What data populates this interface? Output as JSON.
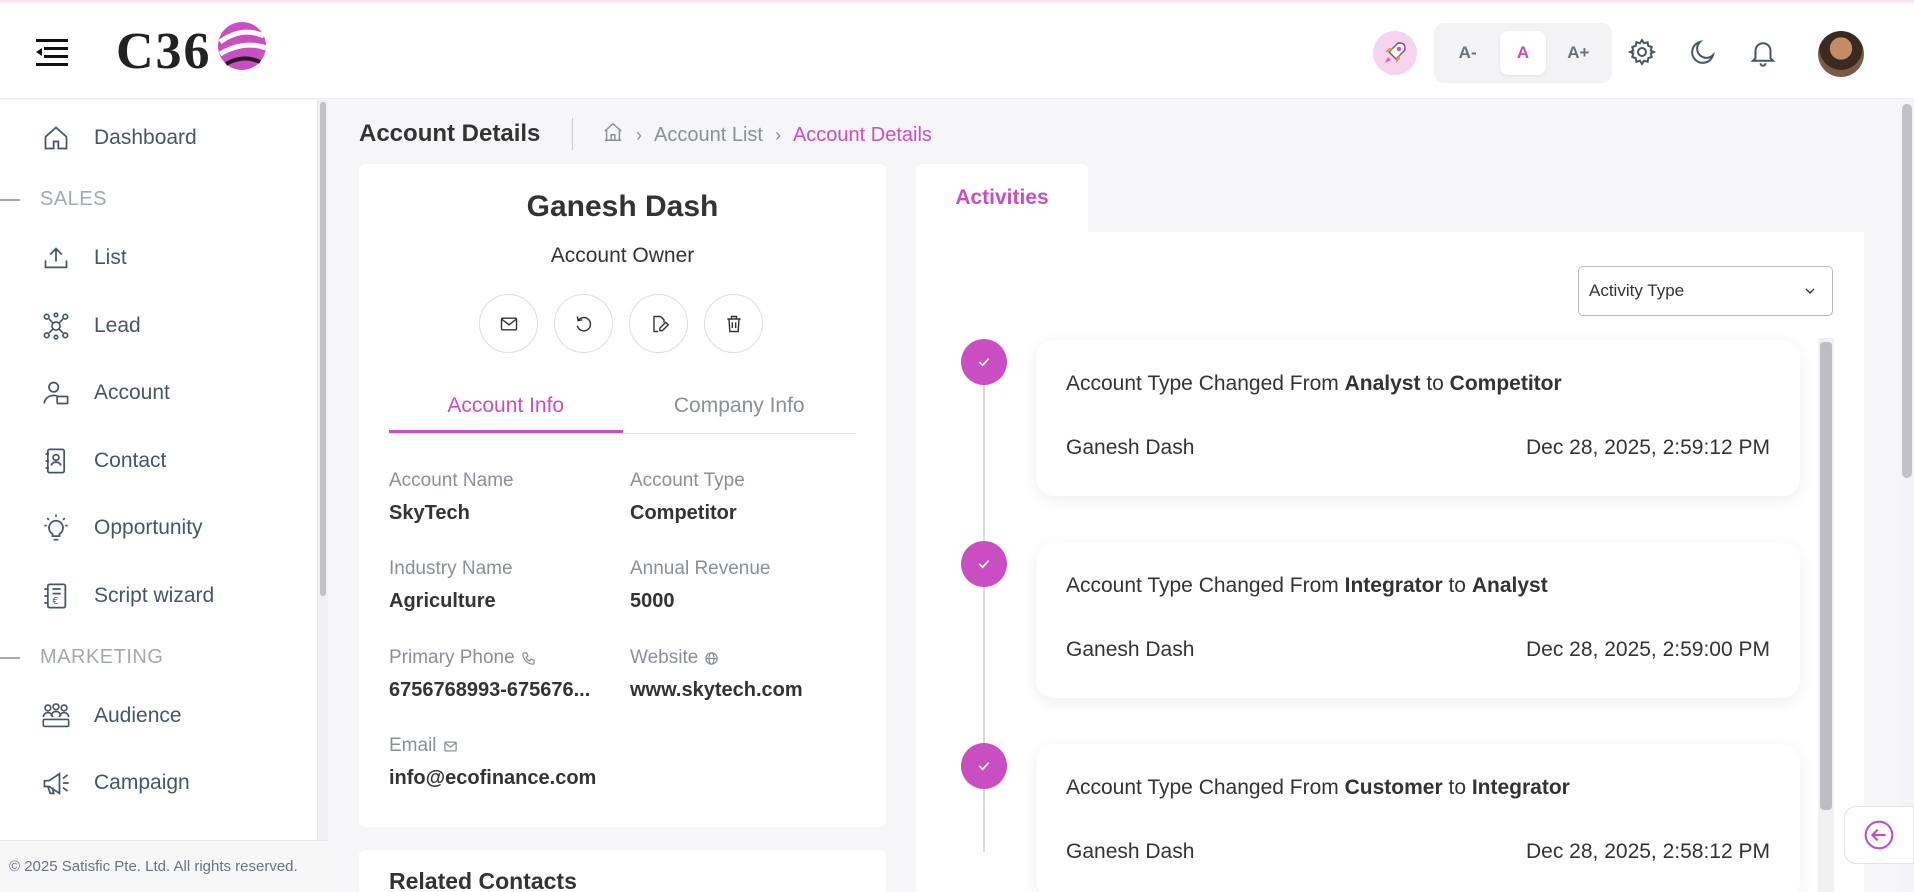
{
  "header": {
    "logo_text": "C36",
    "font_controls": [
      "A-",
      "A",
      "A+"
    ],
    "active_font_control": "A"
  },
  "sidebar": {
    "items": [
      {
        "label": "Dashboard",
        "icon": "home-icon"
      },
      {
        "section": "SALES"
      },
      {
        "label": "List",
        "icon": "upload-icon"
      },
      {
        "label": "Lead",
        "icon": "network-icon"
      },
      {
        "label": "Account",
        "icon": "user-card-icon"
      },
      {
        "label": "Contact",
        "icon": "contact-book-icon"
      },
      {
        "label": "Opportunity",
        "icon": "lightbulb-icon"
      },
      {
        "label": "Script wizard",
        "icon": "script-icon"
      },
      {
        "section": "MARKETING"
      },
      {
        "label": "Audience",
        "icon": "audience-icon"
      },
      {
        "label": "Campaign",
        "icon": "megaphone-icon"
      }
    ],
    "footer": "© 2025 Satisfic Pte. Ltd. All rights reserved."
  },
  "page": {
    "title": "Account Details",
    "breadcrumb": [
      "Account List",
      "Account Details"
    ]
  },
  "account_card": {
    "name": "Ganesh Dash",
    "role": "Account Owner",
    "tabs": [
      "Account Info",
      "Company Info"
    ],
    "active_tab": "Account Info",
    "fields": {
      "account_name": {
        "label": "Account Name",
        "value": "SkyTech"
      },
      "account_type": {
        "label": "Account Type",
        "value": "Competitor"
      },
      "industry_name": {
        "label": "Industry Name",
        "value": "Agriculture"
      },
      "annual_revenue": {
        "label": "Annual Revenue",
        "value": "5000"
      },
      "primary_phone": {
        "label": "Primary Phone",
        "value": "6756768993-675676..."
      },
      "website": {
        "label": "Website",
        "value": "www.skytech.com"
      },
      "email": {
        "label": "Email",
        "value": "info@ecofinance.com"
      }
    }
  },
  "related_contacts": {
    "title": "Related Contacts"
  },
  "activities": {
    "tab_label": "Activities",
    "filter_placeholder": "Activity Type",
    "items": [
      {
        "prefix": "Account Type Changed From",
        "from": "Analyst",
        "joiner": "to",
        "to": "Competitor",
        "user": "Ganesh Dash",
        "time": "Dec 28, 2025, 2:59:12 PM"
      },
      {
        "prefix": "Account Type Changed From",
        "from": "Integrator",
        "joiner": "to",
        "to": "Analyst",
        "user": "Ganesh Dash",
        "time": "Dec 28, 2025, 2:59:00 PM"
      },
      {
        "prefix": "Account Type Changed From",
        "from": "Customer",
        "joiner": "to",
        "to": "Integrator",
        "user": "Ganesh Dash",
        "time": "Dec 28, 2025, 2:58:12 PM"
      }
    ]
  },
  "colors": {
    "accent": "#c94ec2",
    "text": "#333333",
    "muted": "#8a8f98"
  }
}
